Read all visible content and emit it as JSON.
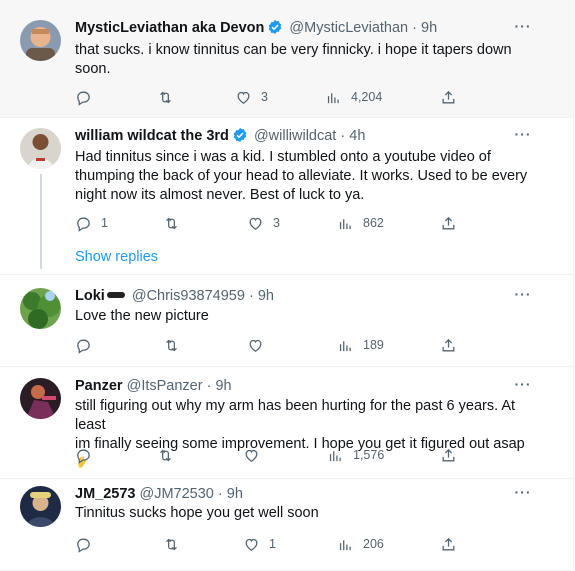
{
  "colors": {
    "accent": "#1d9bf0",
    "muted": "#536471",
    "text": "#0f1419",
    "border": "#eff3f4",
    "highlight_bg": "#f7f7f7"
  },
  "tweets": [
    {
      "name": "MysticLeviathan aka Devon",
      "verified": true,
      "handle": "@MysticLeviathan",
      "dot": "·",
      "time": "9h",
      "lines": [
        "that sucks.  i know tinnitus can be very finnicky.  i hope it tapers down",
        "soon."
      ],
      "replies": "",
      "retweets": "",
      "likes": "3",
      "views": "4,204",
      "icons": {
        "reply": "reply-icon",
        "retweet": "retweet-icon",
        "like": "heart-icon",
        "views": "views-icon",
        "share": "share-icon"
      }
    },
    {
      "name": "william wildcat the 3rd",
      "verified": true,
      "handle": "@williwildcat",
      "dot": "·",
      "time": "4h",
      "lines": [
        "Had tinnitus since i was a kid. I stumbled onto a youtube video of",
        "thumping the back of your head to alleviate. It works. Used to be every",
        "night now its almost never. Best of luck to ya."
      ],
      "replies": "1",
      "retweets": "",
      "likes": "3",
      "views": "862",
      "show_replies": "Show replies"
    },
    {
      "name": "Loki",
      "name_emoji": "hockey-puck-emoji",
      "verified": false,
      "handle": "@Chris93874959",
      "dot": "·",
      "time": "9h",
      "lines": [
        "Love the new picture"
      ],
      "replies": "",
      "retweets": "",
      "likes": "",
      "views": "189"
    },
    {
      "name": "Panzer",
      "verified": false,
      "handle": "@ItsPanzer",
      "dot": "·",
      "time": "9h",
      "lines": [
        "still figuring out why my arm has been hurting for the past 6 years. At least",
        "im finally seeing some improvement. I hope you get it figured out asap"
      ],
      "line_emoji": "fingers-crossed-emoji",
      "replies": "",
      "retweets": "",
      "likes": "",
      "views": "1,576"
    },
    {
      "name": "JM_2573",
      "verified": false,
      "handle": "@JM72530",
      "dot": "·",
      "time": "9h",
      "lines": [
        "Tinnitus sucks hope you get well soon"
      ],
      "replies": "",
      "retweets": "",
      "likes": "1",
      "views": "206"
    }
  ]
}
